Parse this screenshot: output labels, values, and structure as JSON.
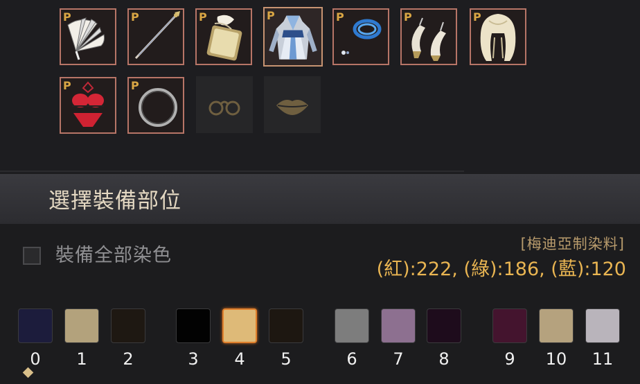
{
  "equipment": {
    "badge": "P",
    "row1": [
      {
        "icon": "fan-icon"
      },
      {
        "icon": "spear-icon"
      },
      {
        "icon": "scroll-icon"
      },
      {
        "icon": "costume-dress-icon",
        "selected": true
      },
      {
        "icon": "bracelet-icon"
      },
      {
        "icon": "shoes-icon"
      },
      {
        "icon": "hair-icon"
      }
    ],
    "row2": [
      {
        "icon": "underwear-icon"
      },
      {
        "icon": "ring-icon"
      },
      {
        "icon": "glasses-icon",
        "empty": true
      },
      {
        "icon": "lips-icon",
        "empty": true
      }
    ]
  },
  "section": {
    "title": "選擇裝備部位"
  },
  "dye_all": {
    "label": "裝備全部染色",
    "checked": false
  },
  "selected_dye": {
    "name": "[梅迪亞制染料]",
    "rgb_text": "(紅):222, (綠):186, (藍):120"
  },
  "palette": {
    "selected_index": 4,
    "swatches": [
      {
        "label": "0",
        "color": "#1c1c3c"
      },
      {
        "label": "1",
        "color": "#b3a27c"
      },
      {
        "label": "2",
        "color": "#1e1812"
      },
      {
        "label": "3",
        "color": "#020202"
      },
      {
        "label": "4",
        "color": "#deba78"
      },
      {
        "label": "5",
        "color": "#1d1711"
      },
      {
        "label": "6",
        "color": "#7d7d7d"
      },
      {
        "label": "7",
        "color": "#8d7090"
      },
      {
        "label": "8",
        "color": "#1e0c1c"
      },
      {
        "label": "9",
        "color": "#44142e"
      },
      {
        "label": "10",
        "color": "#b5a27e"
      },
      {
        "label": "11",
        "color": "#b9b4bb"
      }
    ]
  },
  "colors": {
    "slot_border": "#b77567",
    "accent_gold": "#e9b552",
    "selected_swatch_border": "#e0802c"
  }
}
